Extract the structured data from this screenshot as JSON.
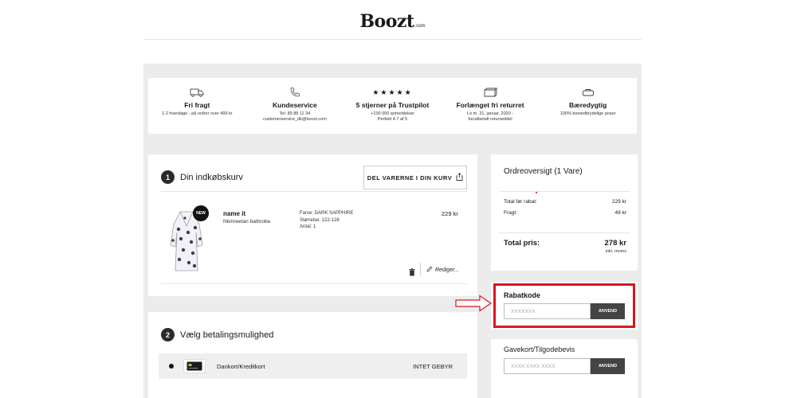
{
  "header": {
    "logo_text": "Boozt",
    "logo_suffix": ".com"
  },
  "usps": [
    {
      "icon": "truck-icon",
      "title": "Fri fragt",
      "sub": "1-2 hverdage - på ordrer over 499 kr"
    },
    {
      "icon": "phone-icon",
      "title": "Kundeservice",
      "sub": "Tel: 89 88 11 34\ncustomerservice_dk@boozt.com"
    },
    {
      "icon": "stars-icon",
      "stars": "★★★★★",
      "title": "5 stjerner på Trustpilot",
      "sub": "+100 000 anmeldelser\nPerfekt 4.7 af 5"
    },
    {
      "icon": "return-box-icon",
      "title": "Forlænget fri returret",
      "sub": "t.o.m. 31. januar, 2020 -\nforudbetalt returseddel"
    },
    {
      "icon": "leaf-icon",
      "title": "Bæredygtig",
      "sub": "100% bionedbrydelige poser"
    }
  ],
  "cart": {
    "step_number": "1",
    "title": "Din indkøbskurv",
    "share_label": "DEL VARERNE I DIN KURV",
    "item": {
      "badge": "NEW",
      "brand": "name it",
      "name": "Nkmreetan bathrobe",
      "attrs": [
        "Farve: DARK SAPPHIRE",
        "Størrelse: 122-128",
        "Antal: 1"
      ],
      "price": "229 kr"
    },
    "edit_label": "Rediger..."
  },
  "payment": {
    "step_number": "2",
    "title": "Vælg betalingsmulighed",
    "option_label": "Dankort/Kreditkort",
    "option_fee": "INTET GEBYR"
  },
  "summary": {
    "title": "Ordreoversigt (1 Vare)",
    "rows": [
      {
        "label": "Total før rabat:",
        "value": "229 kr"
      },
      {
        "label": "Fragt:",
        "value": "49 kr"
      }
    ],
    "total_label": "Total pris:",
    "total_value": "278 kr",
    "total_note": "inkl. moms"
  },
  "discount": {
    "title": "Rabatkode",
    "placeholder": "XXXXXXX",
    "button": "ANVEND"
  },
  "giftcard": {
    "title": "Gavekort/Tilgodebevis",
    "placeholder": "XXXX XXXX XXXX",
    "button": "ANVEND"
  },
  "colors": {
    "highlight": "#d4171e",
    "button": "#444444",
    "page_bg": "#ececec"
  }
}
